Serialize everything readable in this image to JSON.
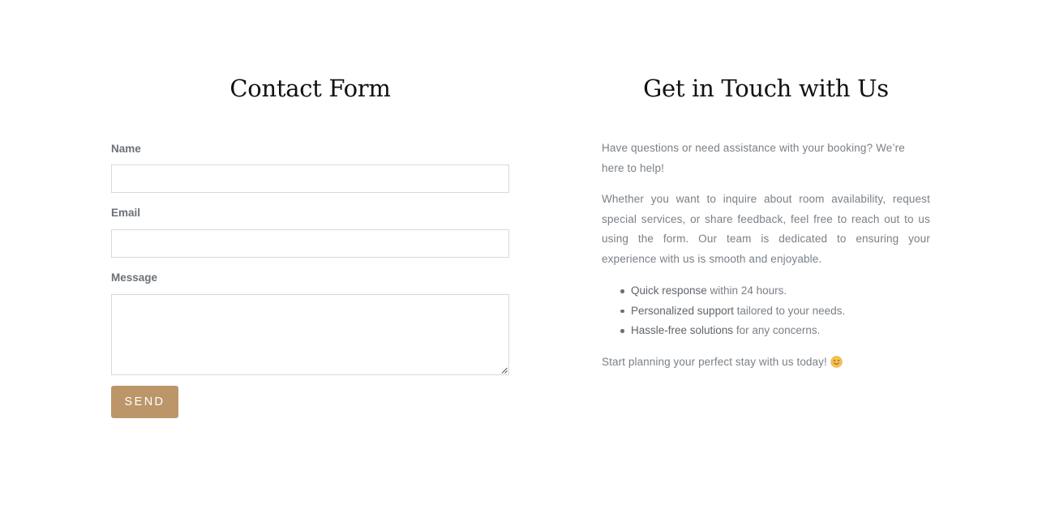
{
  "contact_form": {
    "title": "Contact Form",
    "fields": {
      "name": {
        "label": "Name",
        "value": "",
        "placeholder": ""
      },
      "email": {
        "label": "Email",
        "value": "",
        "placeholder": ""
      },
      "message": {
        "label": "Message",
        "value": "",
        "placeholder": ""
      }
    },
    "submit_label": "SEND",
    "accent_color": "#bc9669"
  },
  "info": {
    "title": "Get in Touch with Us",
    "paragraphs": [
      "Have questions or need assistance with your booking? We’re here to help!",
      "Whether you want to inquire about room availability, request special services, or share feedback, feel free to reach out to us using the form. Our team is dedicated to ensuring your experience with us is smooth and enjoyable."
    ],
    "bullets": [
      {
        "strong": "Quick response",
        "rest": " within 24 hours."
      },
      {
        "strong": "Personalized support",
        "rest": " tailored to your needs."
      },
      {
        "strong": "Hassle-free solutions",
        "rest": " for any concerns."
      }
    ],
    "closing": "Start planning your perfect stay with us today!",
    "closing_emoji_icon": "smiling-face-icon"
  }
}
